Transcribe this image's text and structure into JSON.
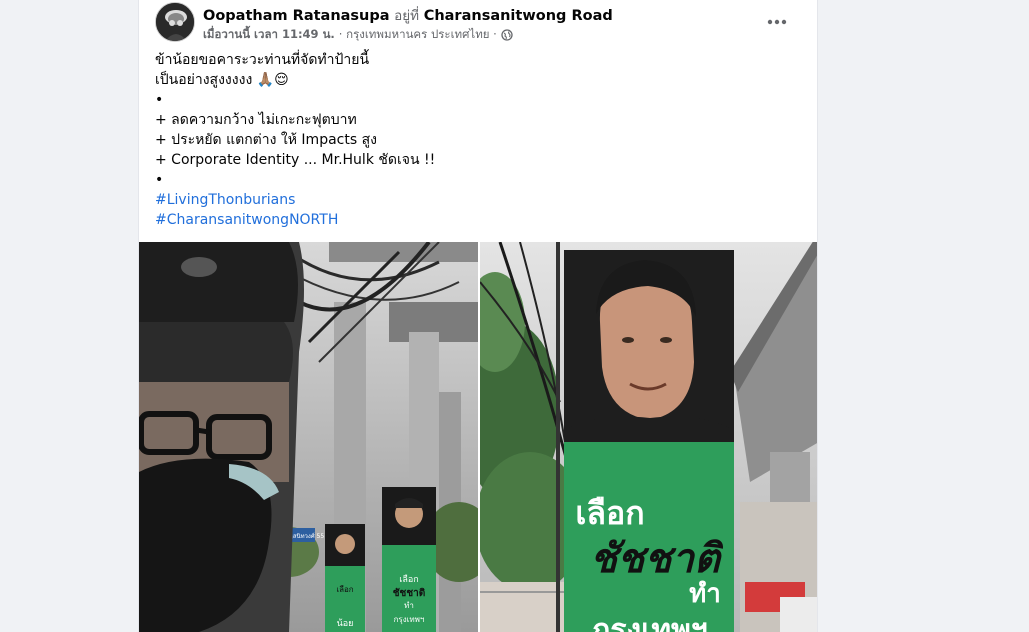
{
  "post": {
    "author": "Oopatham Ratanasupa",
    "at_text": "อยู่ที่",
    "place": "Charansanitwong Road",
    "time": "เมื่อวานนี้ เวลา 11:49 น.",
    "location_suffix": "· กรุงเทพมหานคร ประเทศไทย ·",
    "privacy_icon": "globe-icon",
    "more_icon": "more-options-icon",
    "lines": [
      "ข้าน้อยขอคาระวะท่านที่จัดทำป้ายนี้",
      "เป็นอย่างสูงงงงง 🙏🏽😌",
      "•",
      "+ ลดความกว้าง ไม่เกะกะฟุตบาท",
      "+ ประหยัด แตกต่าง ให้ Impacts สูง",
      "+ Corporate Identity ... Mr.Hulk ชัดเจน !!",
      "•"
    ],
    "hashtags": [
      "#LivingThonburians",
      "#CharansanitwongNORTH"
    ]
  },
  "photos": {
    "left": {
      "street_sign_text": "ซอยจรัญสนิทวงศ์ 55",
      "banner_small_text": "เลือก",
      "banner_small_text2": "ชัชชาติ",
      "banner_small_text3": "ทำ",
      "banner_small_text4": "กรุงเทพฯ",
      "banner_far_text": "น้อย"
    },
    "right": {
      "banner_text1": "เลือก",
      "banner_text2": "ชัชชาติ",
      "banner_text3": "ทำ",
      "banner_text4": "กรุงเทพฯ"
    }
  },
  "colors": {
    "hashtag": "#216fdb",
    "banner_green": "#2e9e5b",
    "meta_gray": "#65676b"
  }
}
